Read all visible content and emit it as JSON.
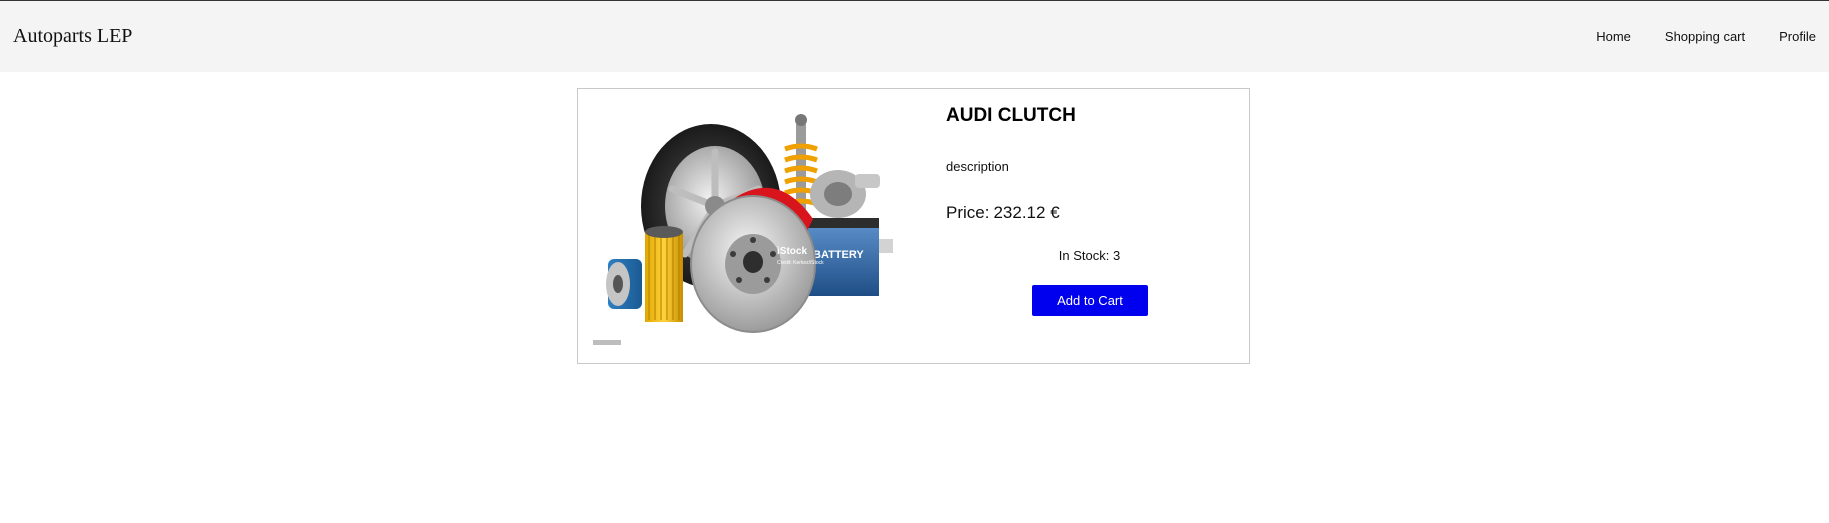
{
  "header": {
    "brand": "Autoparts LEP",
    "nav": [
      {
        "label": "Home"
      },
      {
        "label": "Shopping cart"
      },
      {
        "label": "Profile"
      }
    ]
  },
  "product": {
    "title": "AUDI CLUTCH",
    "description": "description",
    "price_label": "Price:",
    "price": "232.12 €",
    "stock_label": "In Stock:",
    "stock": "3",
    "add_to_cart_label": "Add to Cart",
    "image": {
      "watermark": "iStock",
      "watermark_credit": "Credit: Kerkez/iStock",
      "battery_label": "BATTERY"
    }
  },
  "colors": {
    "navbar_bg": "#f4f4f4",
    "button_bg": "#0000ee",
    "button_text": "#ffffff"
  }
}
